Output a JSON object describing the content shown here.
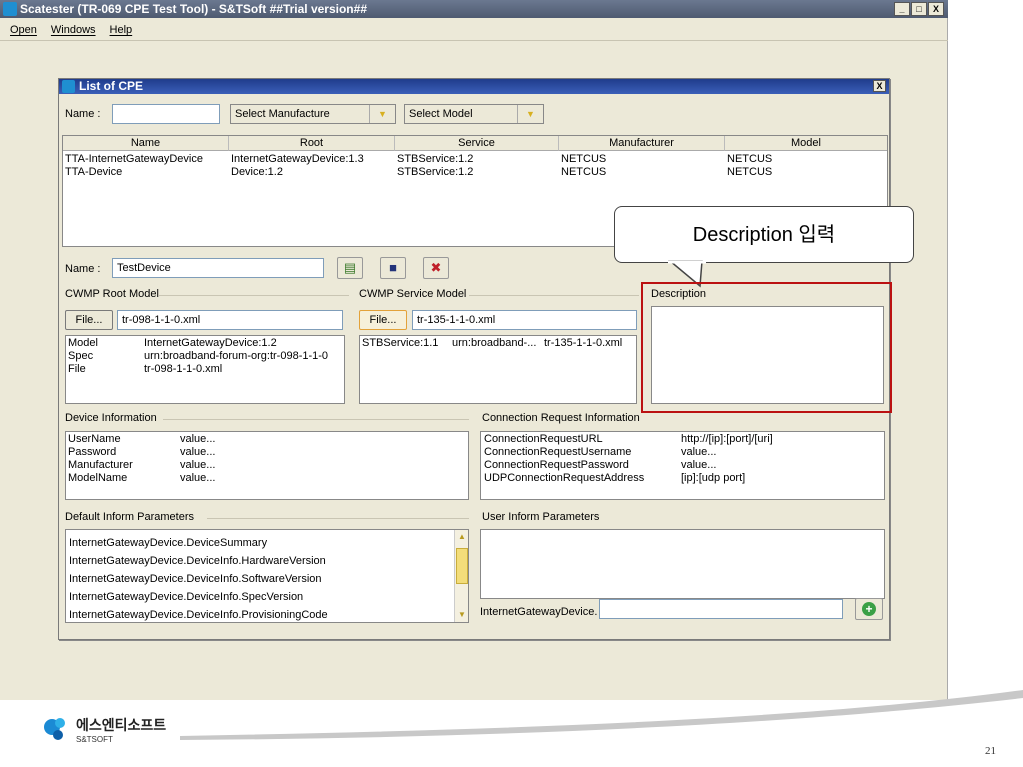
{
  "window": {
    "title": "Scatester (TR-069 CPE Test Tool) - S&TSoft ##Trial version##",
    "minimize": "_",
    "maximize": "□",
    "close": "X"
  },
  "menu": [
    {
      "label": "Open"
    },
    {
      "label": "Windows"
    },
    {
      "label": "Help"
    }
  ],
  "dialog": {
    "title": "List of CPE",
    "close": "X",
    "filter": {
      "name_label": "Name :",
      "name_value": "",
      "manufacturer_select": "Select Manufacture",
      "model_select": "Select Model"
    },
    "cpe_table": {
      "columns": [
        "Name",
        "Root",
        "Service",
        "Manufacturer",
        "Model"
      ],
      "rows": [
        [
          "TTA-InternetGatewayDevice",
          "InternetGatewayDevice:1.3",
          "STBService:1.2",
          "NETCUS",
          "NETCUS"
        ],
        [
          "TTA-Device",
          "Device:1.2",
          "STBService:1.2",
          "NETCUS",
          "NETCUS"
        ]
      ]
    },
    "device_name": {
      "label": "Name :",
      "value": "TestDevice"
    },
    "icons": {
      "new": "new-file-icon",
      "save": "save-icon",
      "delete": "delete-icon"
    },
    "cwmp_root": {
      "title": "CWMP Root Model",
      "file_button": "File...",
      "file_value": "tr-098-1-1-0.xml",
      "rows": [
        [
          "Model",
          "InternetGatewayDevice:1.2"
        ],
        [
          "Spec",
          "urn:broadband-forum-org:tr-098-1-1-0"
        ],
        [
          "File",
          "tr-098-1-1-0.xml"
        ]
      ]
    },
    "cwmp_service": {
      "title": "CWMP Service Model",
      "file_button": "File...",
      "file_value": "tr-135-1-1-0.xml",
      "rows": [
        [
          "STBService:1.1",
          "urn:broadband-...",
          "tr-135-1-1-0.xml"
        ]
      ]
    },
    "description": {
      "title": "Description",
      "value": ""
    },
    "device_info": {
      "title": "Device Information",
      "rows": [
        [
          "UserName",
          "value..."
        ],
        [
          "Password",
          "value..."
        ],
        [
          "Manufacturer",
          "value..."
        ],
        [
          "ModelName",
          "value..."
        ]
      ]
    },
    "connection_request": {
      "title": "Connection Request Information",
      "rows": [
        [
          "ConnectionRequestURL",
          "http://[ip]:[port]/[uri]"
        ],
        [
          "ConnectionRequestUsername",
          "value..."
        ],
        [
          "ConnectionRequestPassword",
          "value..."
        ],
        [
          "UDPConnectionRequestAddress",
          "[ip]:[udp port]"
        ]
      ]
    },
    "default_inform": {
      "title": "Default Inform Parameters",
      "items": [
        "InternetGatewayDevice.DeviceSummary",
        "InternetGatewayDevice.DeviceInfo.HardwareVersion",
        "InternetGatewayDevice.DeviceInfo.SoftwareVersion",
        "InternetGatewayDevice.DeviceInfo.SpecVersion",
        "InternetGatewayDevice.DeviceInfo.ProvisioningCode"
      ]
    },
    "user_inform": {
      "title": "User Inform Parameters",
      "prefix": "InternetGatewayDevice.",
      "input_value": ""
    }
  },
  "callout": {
    "text": "Description 입력"
  },
  "footer": {
    "company_kr": "에스엔티소프트",
    "company_en": "S&TSOFT",
    "page_number": "21"
  },
  "colors": {
    "accent_red": "#b11111",
    "title_blue": "#1f3c8c"
  }
}
